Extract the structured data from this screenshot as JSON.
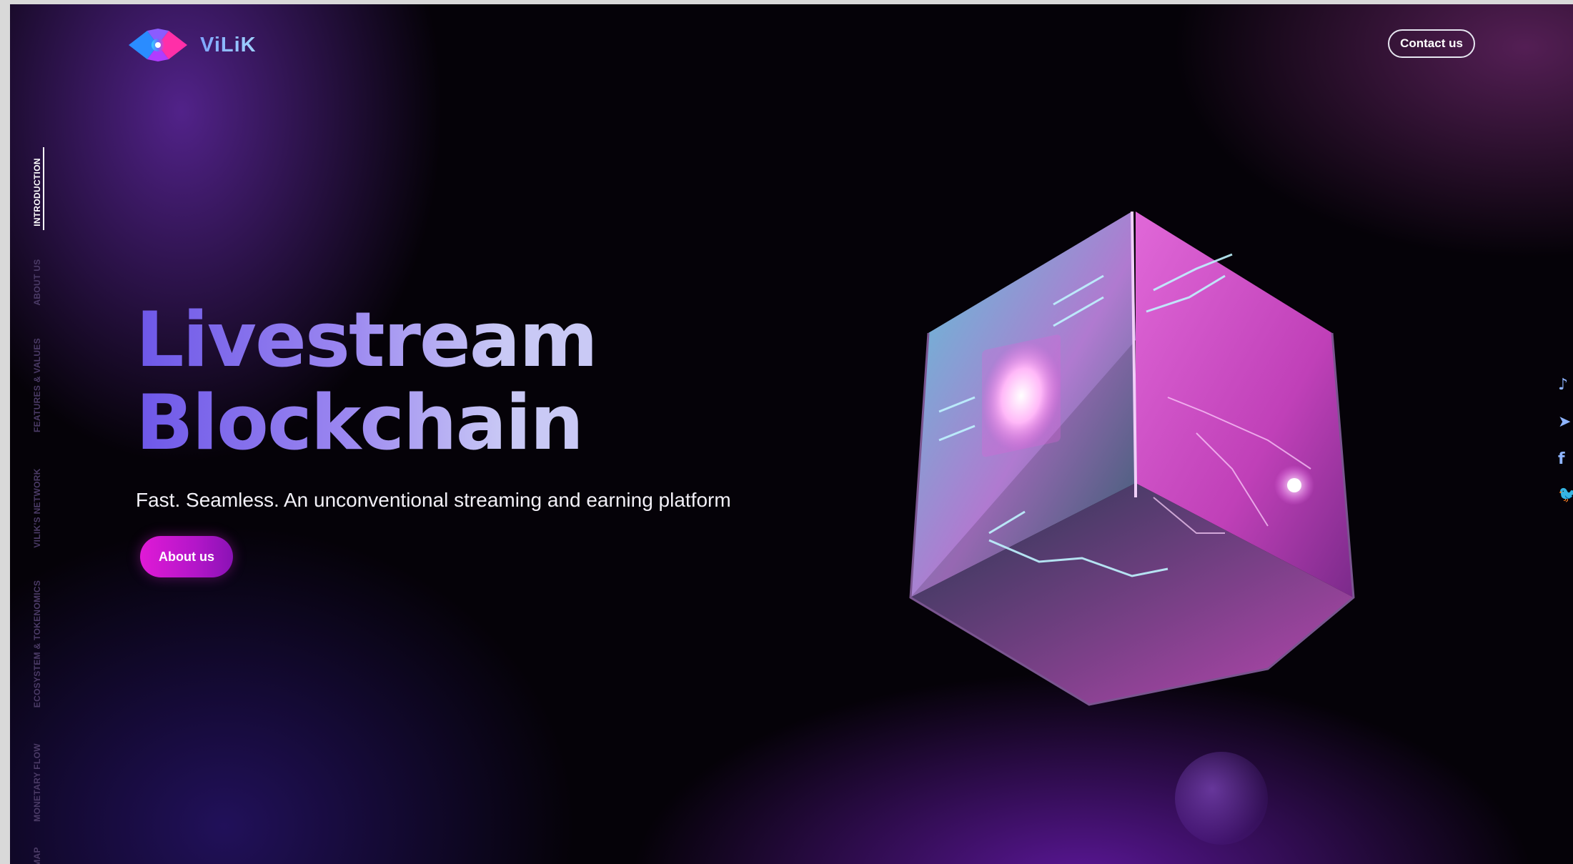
{
  "header": {
    "logo_text": "ViLiK",
    "contact_label": "Contact us"
  },
  "side_nav": {
    "items": [
      {
        "label": "INTRODUCTION",
        "active": true
      },
      {
        "label": "ABOUT US",
        "active": false
      },
      {
        "label": "FEATURES & VALUES",
        "active": false
      },
      {
        "label": "VILIK'S NETWORK",
        "active": false
      },
      {
        "label": "ECOSYSTEM & TOKENOMICS",
        "active": false
      },
      {
        "label": "MONETARY FLOW",
        "active": false
      },
      {
        "label": "MAP",
        "active": false
      }
    ]
  },
  "hero": {
    "title_line1": "Livestream",
    "title_line2": "Blockchain",
    "subtitle": "Fast. Seamless. An unconventional streaming and earning platform",
    "cta_label": "About us"
  },
  "social": {
    "icons": [
      "tiktok-icon",
      "telegram-icon",
      "facebook-icon",
      "twitter-icon"
    ],
    "icon_glyphs": [
      "♪",
      "➤",
      "f",
      "🐦"
    ]
  },
  "colors": {
    "accent_magenta": "#e01ad6",
    "headline_gradient_start": "#6d57e8",
    "headline_gradient_end": "#c9c9f5",
    "background": "#050208"
  }
}
